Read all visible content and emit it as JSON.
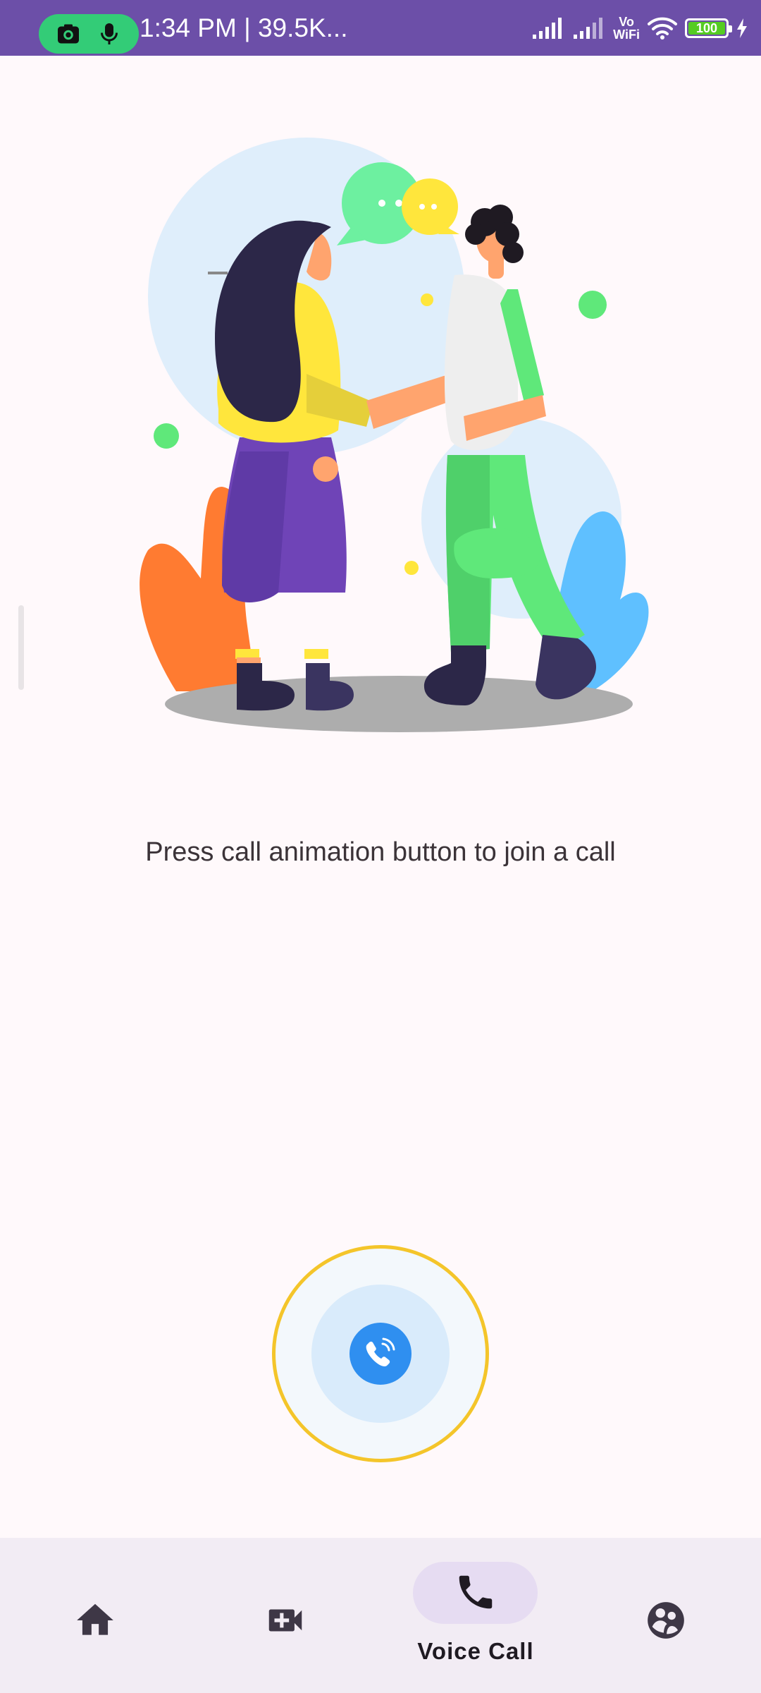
{
  "status_bar": {
    "time_text": "1:34 PM | 39.5K...",
    "network_label_top": "Vo",
    "network_label_bottom": "WiFi",
    "battery_level": "100",
    "colors": {
      "background": "#6c4fa8",
      "pill": "#33cc77",
      "battery_fill": "#55cc22"
    }
  },
  "main": {
    "prompt_text": "Press call animation button to join a call",
    "illustration_icon": "two-people-shaking-hands-illustration",
    "call_button_icon": "phone-ringing-icon",
    "colors": {
      "ring": "#f4c52a",
      "call_button": "#2f8ff0"
    }
  },
  "bottom_nav": {
    "items": [
      {
        "icon": "home-icon",
        "label": ""
      },
      {
        "icon": "video-call-icon",
        "label": ""
      },
      {
        "icon": "phone-icon",
        "label": "Voice Call",
        "selected": true
      },
      {
        "icon": "groups-icon",
        "label": ""
      }
    ],
    "colors": {
      "background": "#f2ecf4",
      "indicator": "#e6dcf2"
    }
  }
}
